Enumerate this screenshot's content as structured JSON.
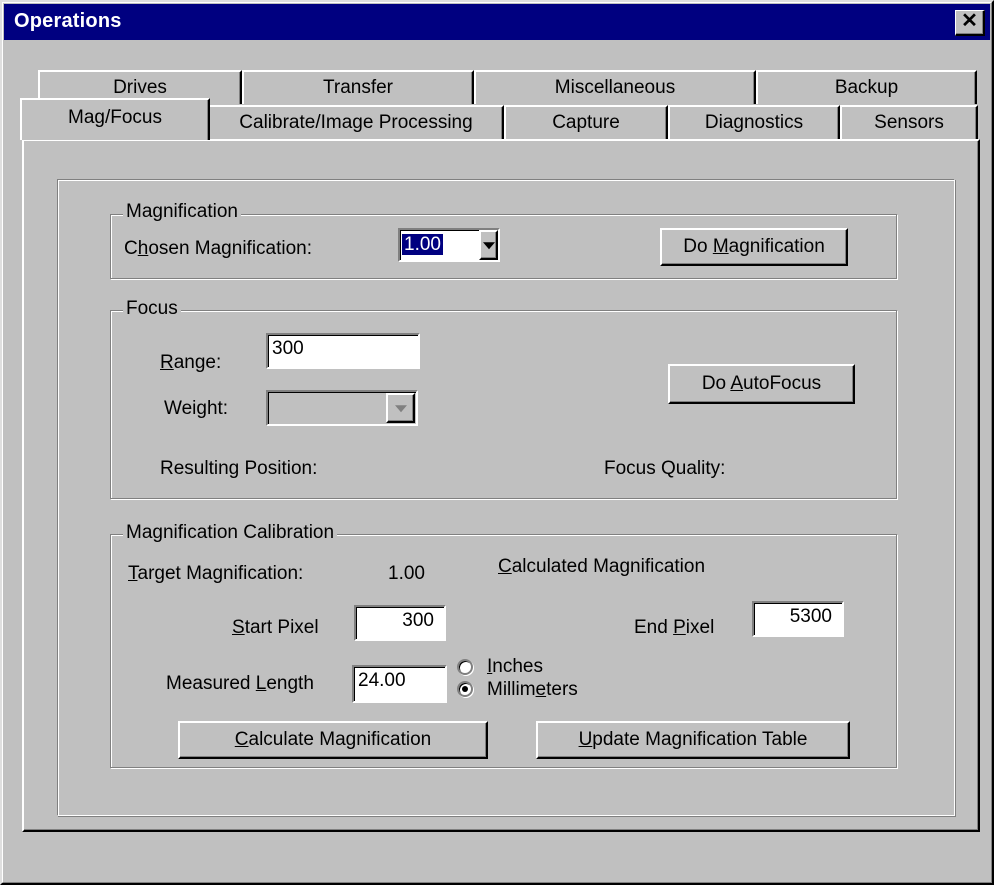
{
  "window": {
    "title": "Operations",
    "close_glyph": "✕"
  },
  "tabs_back": [
    {
      "label": "Drives"
    },
    {
      "label": "Transfer"
    },
    {
      "label": "Miscellaneous"
    },
    {
      "label": "Backup"
    }
  ],
  "tabs_front": [
    {
      "label": "Mag/Focus",
      "active": true
    },
    {
      "label": "Calibrate/Image Processing"
    },
    {
      "label": "Capture"
    },
    {
      "label": "Diagnostics"
    },
    {
      "label": "Sensors"
    }
  ],
  "magnification": {
    "group_label": "Magnification",
    "chosen_label_pre": "C",
    "chosen_label_ul": "h",
    "chosen_label_post": "osen Magnification:",
    "chosen_value": "1.00",
    "button_pre": "Do ",
    "button_ul": "M",
    "button_post": "agnification"
  },
  "focus": {
    "group_label": "Focus",
    "range_ul": "R",
    "range_post": "ange:",
    "range_value": "300",
    "weight_label": "Weight:",
    "weight_value": "",
    "resulting_position_label": "Resulting Position:",
    "focus_quality_label": "Focus Quality:",
    "button_pre": "Do ",
    "button_ul": "A",
    "button_post": "utoFocus"
  },
  "calibration": {
    "group_label": "Magnification Calibration",
    "target_ul": "T",
    "target_post": "arget Magnification:",
    "target_value": "1.00",
    "calculated_ul": "C",
    "calculated_post": "alculated Magnification",
    "start_ul": "S",
    "start_post": "tart Pixel",
    "start_value": "300",
    "end_pre": "End ",
    "end_ul": "P",
    "end_post": "ixel",
    "end_value": "5300",
    "measured_pre": "Measured ",
    "measured_ul": "L",
    "measured_post": "ength",
    "measured_value": "24.00",
    "unit_options": [
      {
        "pre": "",
        "ul": "I",
        "post": "nches",
        "selected": false
      },
      {
        "pre": "Millim",
        "ul": "e",
        "post": "ters",
        "selected": true
      }
    ],
    "calc_button_ul": "C",
    "calc_button_post": "alculate Magnification",
    "update_button_ul": "U",
    "update_button_post": "pdate Magnification Table"
  },
  "colors": {
    "titlebar": "#000080",
    "face": "#c0c0c0",
    "selection": "#000080"
  }
}
